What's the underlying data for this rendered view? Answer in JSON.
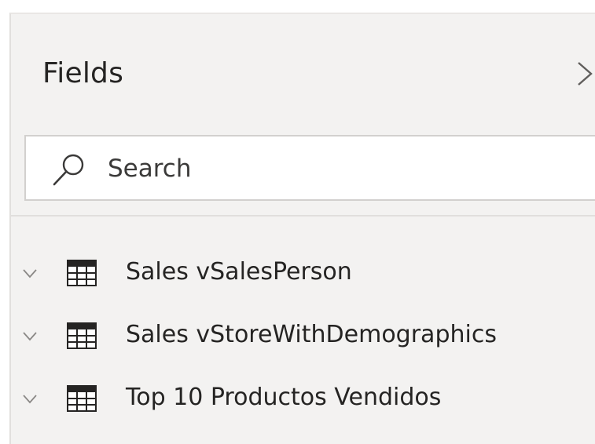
{
  "panel": {
    "title": "Fields",
    "collapse_icon": "chevron-right-icon"
  },
  "search": {
    "placeholder": "Search",
    "value": "",
    "icon": "search-icon"
  },
  "fields": {
    "items": [
      {
        "label": "Sales vSalesPerson",
        "icon": "table-icon",
        "expand_icon": "chevron-down-icon"
      },
      {
        "label": "Sales vStoreWithDemographics",
        "icon": "table-icon",
        "expand_icon": "chevron-down-icon"
      },
      {
        "label": "Top 10 Productos Vendidos",
        "icon": "table-icon",
        "expand_icon": "chevron-down-icon"
      }
    ]
  },
  "colors": {
    "pane_background": "#f3f2f1",
    "text": "#252423",
    "border": "#d2d0ce"
  }
}
